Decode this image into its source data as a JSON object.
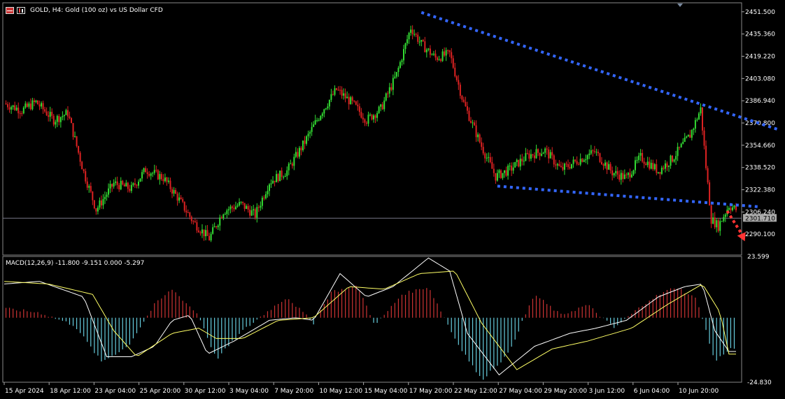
{
  "header": {
    "title": "GOLD, H4:  Gold (100 oz) vs US Dollar CFD",
    "icons": [
      "table-icon",
      "candles-icon"
    ]
  },
  "colors": {
    "background": "#000000",
    "bull": "#33dd33",
    "bear": "#dd2222",
    "trendline": "#3366ff",
    "forecast_arrow": "#ff3333",
    "axis_text": "#ffffff",
    "macd_positive": "#cc3333",
    "macd_negative": "#66ccdd",
    "macd_line": "#ffffff",
    "signal_line": "#ffff66"
  },
  "chart_data": [
    {
      "type": "candlestick",
      "symbol": "GOLD",
      "timeframe": "H4",
      "ylim": [
        2275,
        2458
      ],
      "y_ticks": [
        2451.5,
        2435.36,
        2419.22,
        2403.08,
        2386.94,
        2370.8,
        2354.66,
        2338.52,
        2322.38,
        2306.24,
        2290.1
      ],
      "current_price": 2301.71,
      "current_price_label": "2301.710",
      "x_tick_labels": [
        "15 Apr 2024",
        "18 Apr 12:00",
        "23 Apr 04:00",
        "25 Apr 20:00",
        "30 Apr 12:00",
        "3 May 04:00",
        "7 May 20:00",
        "10 May 12:00",
        "15 May 04:00",
        "17 May 20:00",
        "22 May 12:00",
        "27 May 04:00",
        "29 May 20:00",
        "3 Jun 12:00",
        "6 Jun 04:00",
        "10 Jun 20:00"
      ],
      "close_path": [
        [
          0,
          2385
        ],
        [
          10,
          2380
        ],
        [
          18,
          2386
        ],
        [
          28,
          2373
        ],
        [
          36,
          2378
        ],
        [
          45,
          2335
        ],
        [
          52,
          2308
        ],
        [
          62,
          2327
        ],
        [
          72,
          2323
        ],
        [
          80,
          2337
        ],
        [
          90,
          2331
        ],
        [
          98,
          2317
        ],
        [
          107,
          2299
        ],
        [
          116,
          2287
        ],
        [
          124,
          2307
        ],
        [
          134,
          2312
        ],
        [
          142,
          2304
        ],
        [
          150,
          2328
        ],
        [
          160,
          2336
        ],
        [
          170,
          2357
        ],
        [
          180,
          2380
        ],
        [
          188,
          2395
        ],
        [
          197,
          2385
        ],
        [
          205,
          2373
        ],
        [
          213,
          2381
        ],
        [
          222,
          2406
        ],
        [
          230,
          2440
        ],
        [
          236,
          2428
        ],
        [
          244,
          2418
        ],
        [
          252,
          2421
        ],
        [
          260,
          2385
        ],
        [
          270,
          2354
        ],
        [
          278,
          2332
        ],
        [
          286,
          2337
        ],
        [
          296,
          2347
        ],
        [
          306,
          2351
        ],
        [
          315,
          2337
        ],
        [
          325,
          2344
        ],
        [
          334,
          2350
        ],
        [
          344,
          2335
        ],
        [
          352,
          2331
        ],
        [
          360,
          2346
        ],
        [
          370,
          2336
        ],
        [
          378,
          2345
        ],
        [
          388,
          2362
        ],
        [
          394,
          2381
        ],
        [
          397,
          2339
        ],
        [
          400,
          2301
        ],
        [
          404,
          2296
        ],
        [
          410,
          2311
        ],
        [
          414,
          2308
        ]
      ],
      "trendlines": [
        {
          "start": [
            236,
            2451
          ],
          "end": [
            438,
            2366
          ]
        },
        {
          "start": [
            279,
            2325
          ],
          "end": [
            427,
            2310
          ]
        }
      ],
      "forecast_arrow": {
        "start": [
          409,
          2307
        ],
        "end": [
          419,
          2285
        ]
      }
    },
    {
      "type": "macd",
      "label": "MACD(12,26,9) -11.800 -9.151 0.000 -5.297",
      "params": "12,26,9",
      "ylim": [
        -24.83,
        23.599
      ],
      "y_ticks": [
        23.599,
        -24.83
      ],
      "histogram_path": [
        [
          0,
          3.5
        ],
        [
          20,
          2
        ],
        [
          40,
          -3
        ],
        [
          55,
          -17
        ],
        [
          70,
          -11
        ],
        [
          85,
          5
        ],
        [
          95,
          11
        ],
        [
          110,
          1
        ],
        [
          120,
          -16
        ],
        [
          135,
          -5
        ],
        [
          150,
          3
        ],
        [
          160,
          8
        ],
        [
          175,
          -2
        ],
        [
          185,
          10
        ],
        [
          200,
          12
        ],
        [
          210,
          -3
        ],
        [
          225,
          9
        ],
        [
          240,
          12
        ],
        [
          255,
          -8
        ],
        [
          270,
          -24
        ],
        [
          285,
          -14
        ],
        [
          300,
          9
        ],
        [
          315,
          1
        ],
        [
          330,
          5
        ],
        [
          345,
          -4
        ],
        [
          365,
          7
        ],
        [
          380,
          12
        ],
        [
          392,
          7
        ],
        [
          402,
          -17
        ],
        [
          410,
          -12
        ]
      ],
      "macd_path": [
        [
          0,
          13
        ],
        [
          20,
          14
        ],
        [
          45,
          8
        ],
        [
          58,
          -15
        ],
        [
          72,
          -15
        ],
        [
          85,
          -11
        ],
        [
          95,
          -1
        ],
        [
          105,
          1
        ],
        [
          115,
          -14
        ],
        [
          130,
          -9
        ],
        [
          150,
          -1
        ],
        [
          165,
          0
        ],
        [
          175,
          -1
        ],
        [
          190,
          17
        ],
        [
          205,
          8
        ],
        [
          220,
          12
        ],
        [
          240,
          23
        ],
        [
          252,
          18
        ],
        [
          262,
          -6
        ],
        [
          280,
          -22
        ],
        [
          300,
          -11
        ],
        [
          320,
          -6
        ],
        [
          335,
          -4
        ],
        [
          352,
          -1
        ],
        [
          370,
          8
        ],
        [
          385,
          12
        ],
        [
          395,
          13
        ],
        [
          402,
          -5
        ],
        [
          410,
          -13
        ]
      ],
      "signal_path": [
        [
          0,
          14
        ],
        [
          25,
          13
        ],
        [
          50,
          9
        ],
        [
          62,
          -5
        ],
        [
          75,
          -15
        ],
        [
          95,
          -6
        ],
        [
          110,
          -4
        ],
        [
          120,
          -8
        ],
        [
          135,
          -8
        ],
        [
          155,
          -1
        ],
        [
          175,
          0
        ],
        [
          195,
          12
        ],
        [
          215,
          11
        ],
        [
          235,
          17
        ],
        [
          255,
          18
        ],
        [
          270,
          -2
        ],
        [
          290,
          -20
        ],
        [
          310,
          -12
        ],
        [
          330,
          -9
        ],
        [
          355,
          -4
        ],
        [
          375,
          5
        ],
        [
          395,
          13
        ],
        [
          405,
          2
        ],
        [
          410,
          -14
        ]
      ]
    }
  ]
}
